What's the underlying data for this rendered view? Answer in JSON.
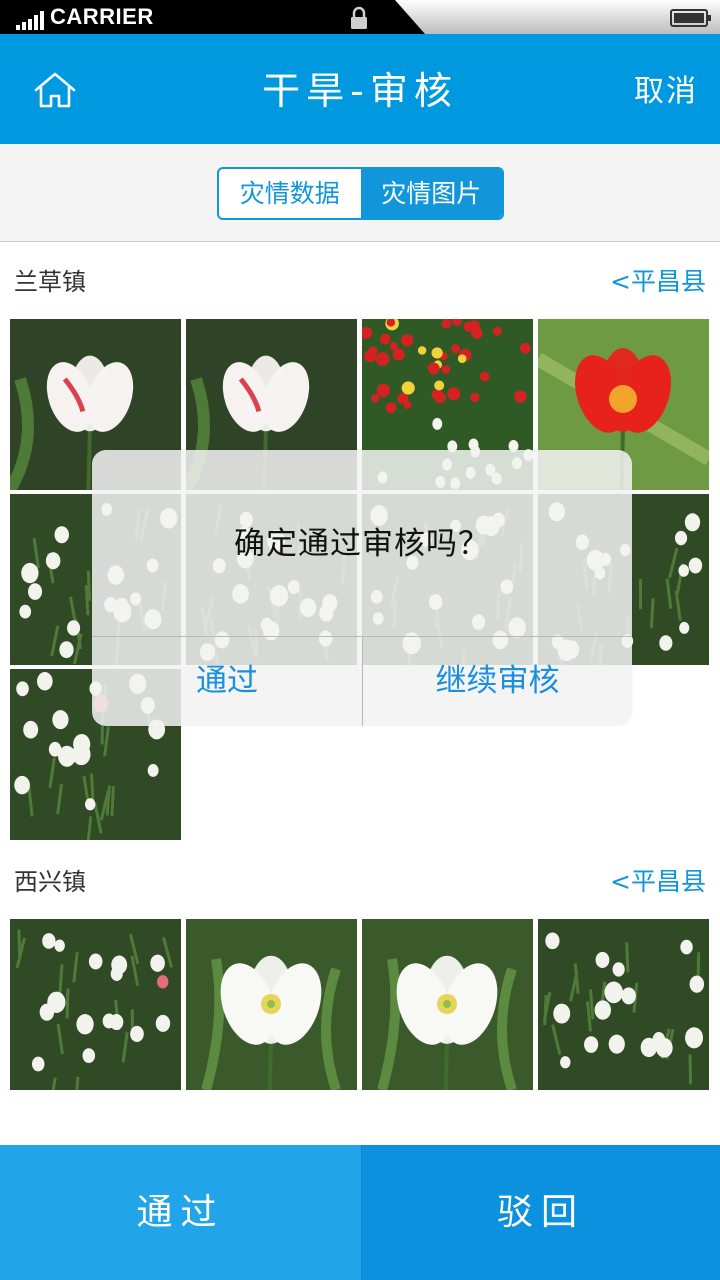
{
  "status_bar": {
    "carrier": "CARRIER",
    "icons": [
      "signal-icon",
      "lock-icon",
      "battery-icon"
    ]
  },
  "nav": {
    "title": "干旱-审核",
    "cancel_label": "取消",
    "home_icon": "home-icon"
  },
  "tabs": [
    {
      "label": "灾情数据",
      "active": false
    },
    {
      "label": "灾情图片",
      "active": true
    }
  ],
  "sections": [
    {
      "name": "兰草镇",
      "link": "<平昌县",
      "photo_count": 9
    },
    {
      "name": "西兴镇",
      "link": "<平昌县",
      "photo_count": 4
    }
  ],
  "dialog": {
    "message": "确定通过审核吗？",
    "confirm_label": "通过",
    "continue_label": "继续审核"
  },
  "bottom_bar": {
    "approve_label": "通过",
    "reject_label": "驳回"
  },
  "colors": {
    "primary": "#0099e0",
    "accent": "#1296db",
    "dialog_button": "#1a8fe0"
  }
}
